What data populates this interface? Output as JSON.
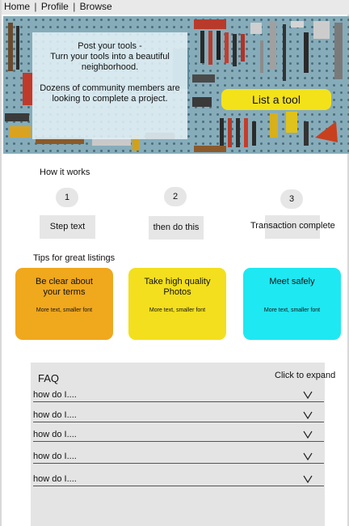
{
  "nav": {
    "home": "Home",
    "profile": "Profile",
    "browse": "Browse",
    "separator": "|"
  },
  "hero": {
    "line1": "Post your tools -",
    "line2": "Turn your tools into a beautiful neighborhood.",
    "line3": "Dozens of community members are looking to complete a project.",
    "cta_label": "List a tool",
    "background_image": "pegboard-tools-photo"
  },
  "how_it_works": {
    "title": "How it works",
    "steps": [
      {
        "number": "1",
        "text": "Step text"
      },
      {
        "number": "2",
        "text": "then do this"
      },
      {
        "number": "3",
        "text": "Transaction complete"
      }
    ]
  },
  "tips": {
    "title": "Tips for great listings",
    "cards": [
      {
        "title": "Be clear about your terms",
        "sub": "More text, smaller font",
        "color": "#f0a81d"
      },
      {
        "title": "Take high quality Photos",
        "sub": "More text, smaller font",
        "color": "#f3df1d"
      },
      {
        "title": "Meet safely",
        "sub": "More text, smaller font",
        "color": "#1ee8f2"
      }
    ]
  },
  "faq": {
    "title": "FAQ",
    "hint": "Click to expand",
    "expand_icon": "chevron-down-icon",
    "items": [
      "how do I....",
      "how do I....",
      "how do I....",
      "how do I....",
      "how do I...."
    ]
  },
  "colors": {
    "hero_overlay": "#e2f0f6",
    "cta": "#f3e21a",
    "neutral_box": "#e6e6e6",
    "faq_panel": "#e4e4e4"
  }
}
